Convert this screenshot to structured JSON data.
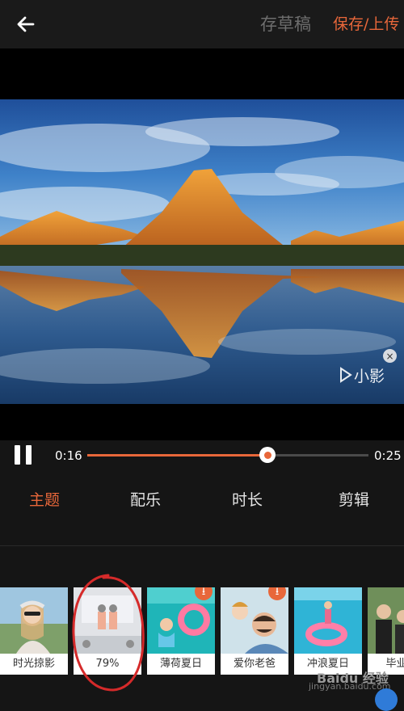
{
  "topbar": {
    "back_icon": "arrow-left-icon",
    "draft_label": "存草稿",
    "save_label": "保存/上传",
    "accent_color": "#e8673a"
  },
  "video": {
    "watermark_text": "小影",
    "watermark_close": "×"
  },
  "player": {
    "current_time": "0:16",
    "total_time": "0:25",
    "progress": 0.64
  },
  "tabs": [
    {
      "label": "主题",
      "active": true
    },
    {
      "label": "配乐",
      "active": false
    },
    {
      "label": "时长",
      "active": false
    },
    {
      "label": "剪辑",
      "active": false
    }
  ],
  "themes": [
    {
      "label": "时光掠影",
      "download": false
    },
    {
      "label": "79%",
      "download": false,
      "loading": true
    },
    {
      "label": "薄荷夏日",
      "download": true
    },
    {
      "label": "爱你老爸",
      "download": true
    },
    {
      "label": "冲浪夏日",
      "download": false
    },
    {
      "label": "毕业季",
      "download": false
    }
  ],
  "footer": {
    "site_text": "jingyan.baidu.com",
    "logo_text": "Baidu 经验"
  }
}
